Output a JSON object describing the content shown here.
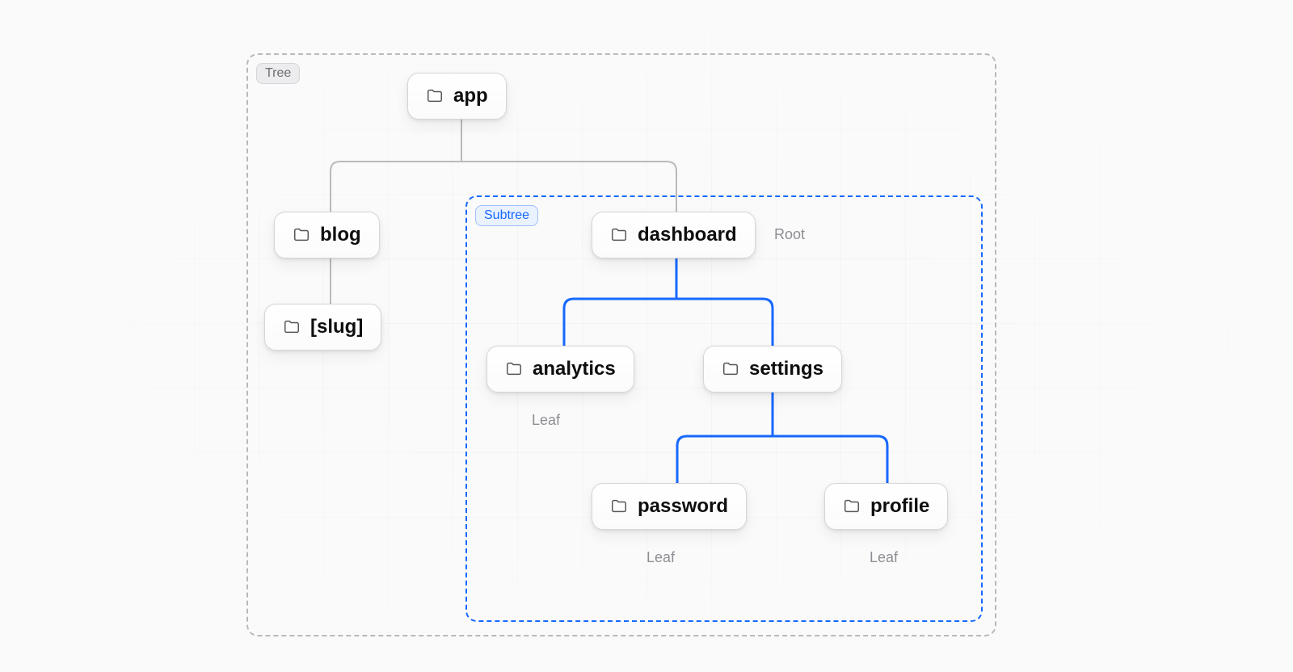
{
  "regions": {
    "tree": {
      "label": "Tree"
    },
    "subtree": {
      "label": "Subtree"
    }
  },
  "nodes": {
    "app": {
      "label": "app"
    },
    "blog": {
      "label": "blog"
    },
    "slug": {
      "label": "[slug]"
    },
    "dashboard": {
      "label": "dashboard"
    },
    "analytics": {
      "label": "analytics"
    },
    "settings": {
      "label": "settings"
    },
    "password": {
      "label": "password"
    },
    "profile": {
      "label": "profile"
    }
  },
  "annotations": {
    "dashboard_root": "Root",
    "analytics_leaf": "Leaf",
    "password_leaf": "Leaf",
    "profile_leaf": "Leaf"
  },
  "colors": {
    "accent_blue": "#1668ff",
    "line_gray": "#b9b9be",
    "text_muted": "#8d8d94"
  }
}
